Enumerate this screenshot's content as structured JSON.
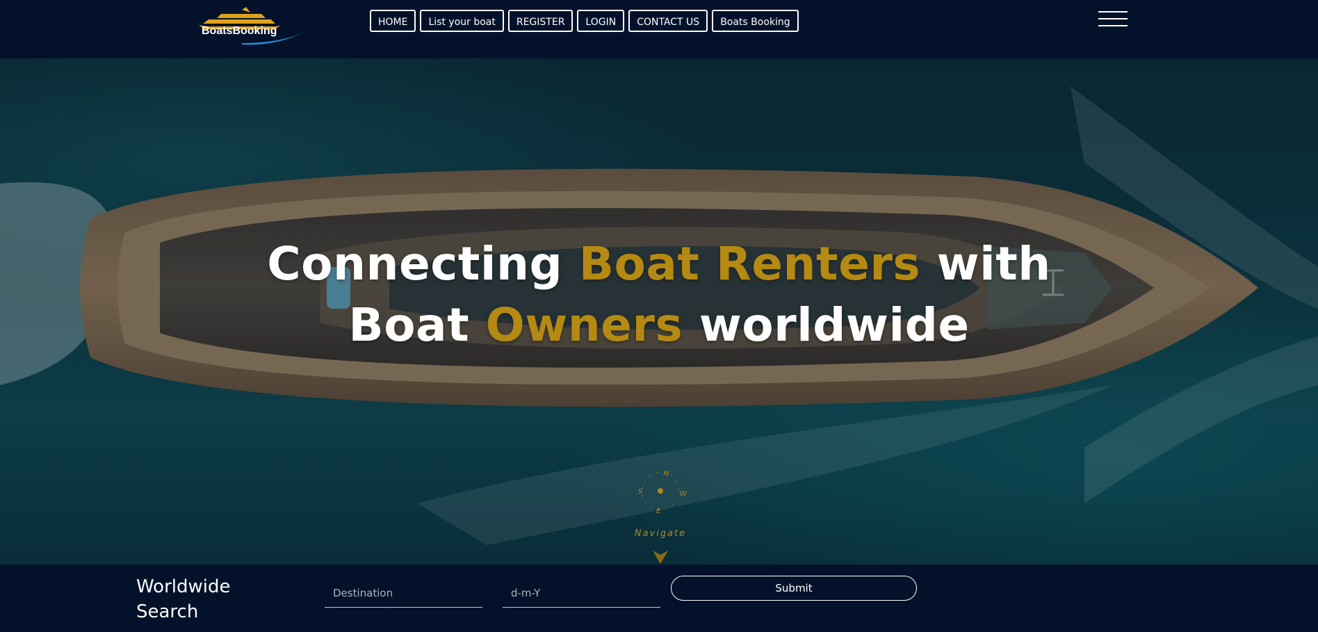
{
  "brand": {
    "logo_text": "BoatsBooking",
    "logo_gold": "#e0a21b",
    "logo_wave": "#2a8ad8"
  },
  "nav": {
    "items": [
      {
        "label": "HOME"
      },
      {
        "label": "List your boat"
      },
      {
        "label": "REGISTER"
      },
      {
        "label": "LOGIN"
      },
      {
        "label": "CONTACT US"
      },
      {
        "label": "Boats Booking"
      }
    ],
    "menu_icon": "hamburger-icon"
  },
  "hero": {
    "line1_pre": "Connecting ",
    "line1_accent": "Boat Renters",
    "line1_post": " with",
    "line2_pre": "Boat ",
    "line2_accent": "Owners",
    "line2_post": " worldwide",
    "accent_color": "#b58a12"
  },
  "compass": {
    "letters": {
      "n": "N",
      "w": "W",
      "e": "E",
      "s": "S"
    },
    "navigate_label": "Navigate",
    "icon": "compass-icon"
  },
  "search": {
    "title_line1": "Worldwide",
    "title_line2": "Search",
    "destination_placeholder": "Destination",
    "date_placeholder": "d-m-Y",
    "submit_label": "Submit"
  }
}
